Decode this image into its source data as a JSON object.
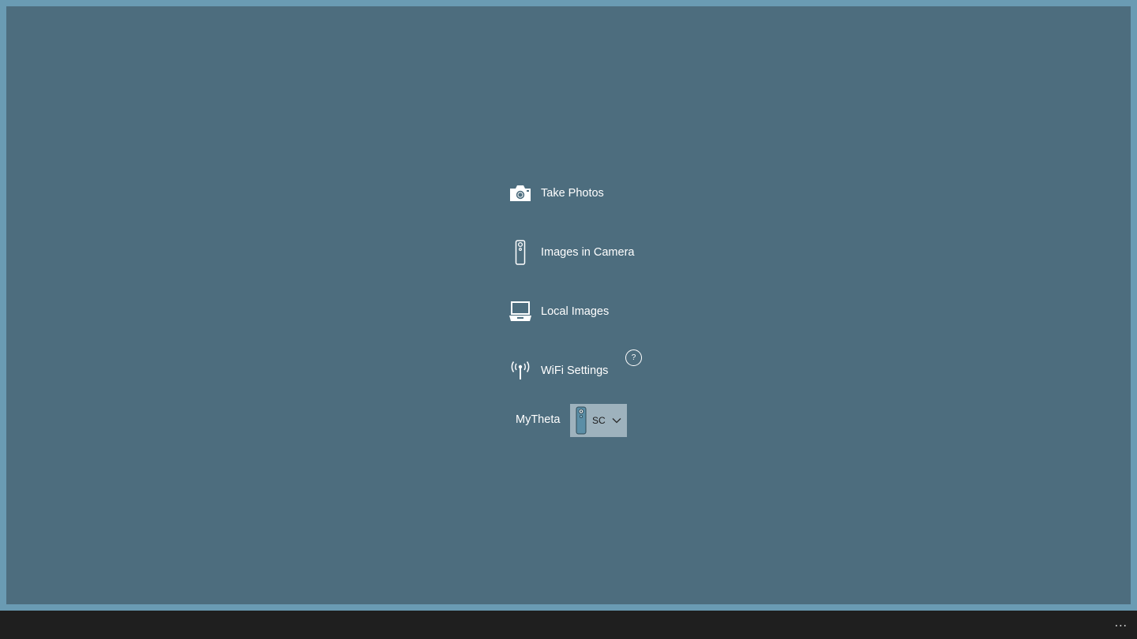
{
  "menu": {
    "take_photos": {
      "label": "Take Photos",
      "icon": "camera-icon"
    },
    "images_in_camera": {
      "label": "Images in Camera",
      "icon": "theta-camera-icon"
    },
    "local_images": {
      "label": "Local Images",
      "icon": "laptop-icon"
    },
    "wifi_settings": {
      "label": "WiFi Settings",
      "icon": "antenna-icon"
    }
  },
  "help": {
    "label": "?"
  },
  "mytheta": {
    "label": "MyTheta",
    "selected": "SC"
  },
  "taskbar": {
    "more_label": "..."
  },
  "colors": {
    "frame_border": "#6a9bb3",
    "background": "#4d6d7e",
    "taskbar": "#1f1f1f",
    "select_bg": "#9eb2bd"
  }
}
